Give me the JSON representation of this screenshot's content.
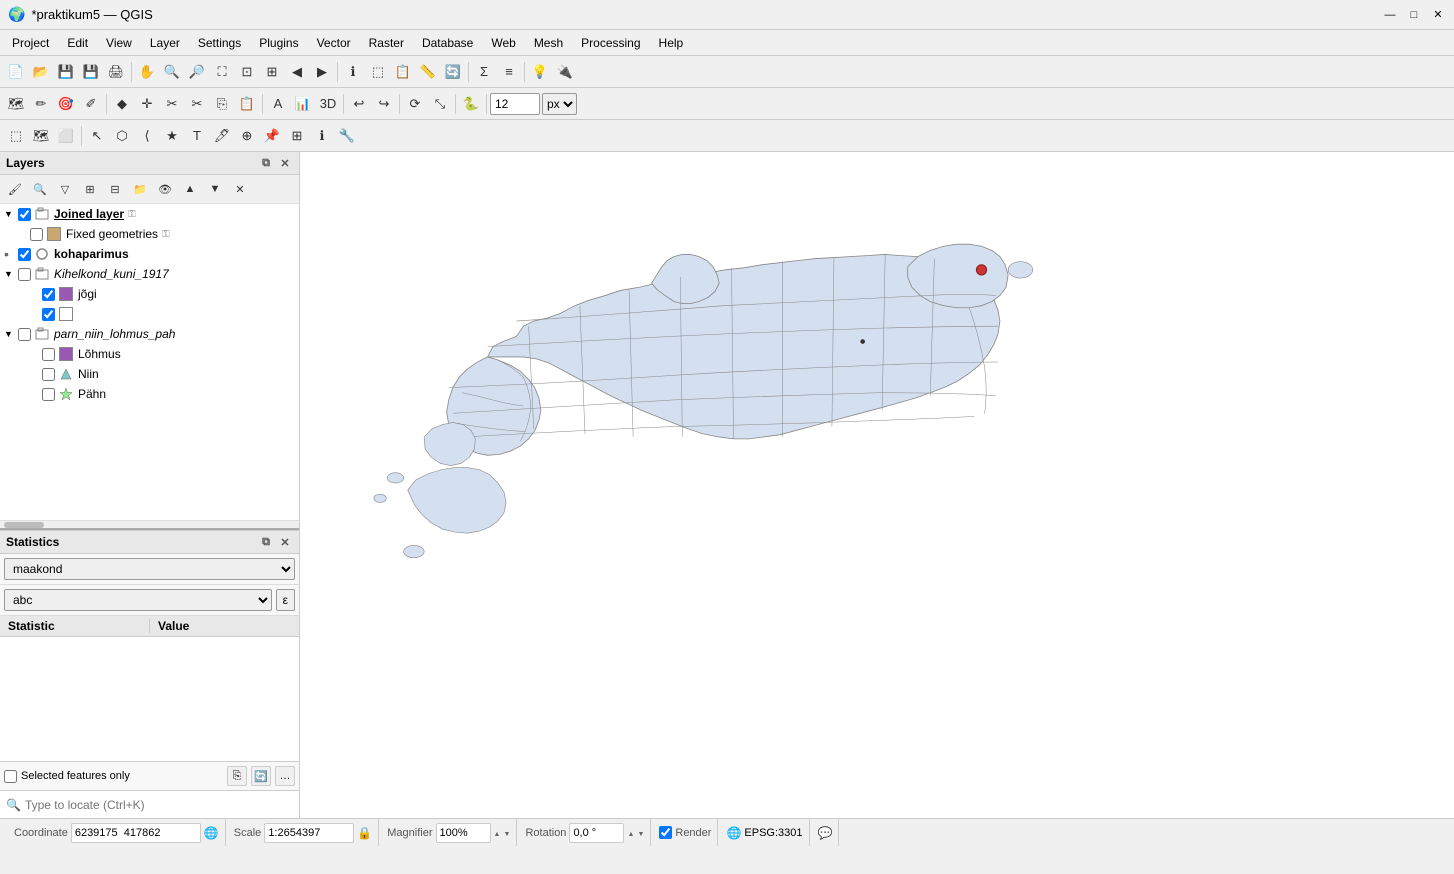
{
  "titleBar": {
    "title": "*praktikum5 — QGIS",
    "minimize": "—",
    "maximize": "□",
    "close": "✕"
  },
  "menuBar": {
    "items": [
      "Project",
      "Edit",
      "View",
      "Layer",
      "Settings",
      "Plugins",
      "Vector",
      "Raster",
      "Database",
      "Web",
      "Mesh",
      "Processing",
      "Help"
    ]
  },
  "toolbars": {
    "fontSizeValue": "12",
    "fontSizeUnit": "px"
  },
  "layersPanel": {
    "title": "Layers",
    "layers": [
      {
        "id": "joined-layer",
        "name": "Joined layer",
        "type": "group",
        "bold": true,
        "underline": true,
        "checked": true,
        "indent": 0,
        "expandable": true
      },
      {
        "id": "fixed-geometries",
        "name": "Fixed geometries",
        "type": "layer",
        "bold": false,
        "italic": false,
        "checked": false,
        "indent": 1,
        "color": "tan"
      },
      {
        "id": "kohaparimus",
        "name": "kohaparimus",
        "type": "layer",
        "bold": true,
        "checked": true,
        "indent": 0,
        "dot": true
      },
      {
        "id": "kihelkond",
        "name": "Kihelkond_kuni_1917",
        "type": "group",
        "italic": true,
        "checked": false,
        "indent": 0,
        "expandable": true
      },
      {
        "id": "jogi",
        "name": "jõgi",
        "type": "layer",
        "checked": true,
        "indent": 2,
        "color": "purple"
      },
      {
        "id": "blank-layer",
        "name": "",
        "type": "layer",
        "checked": true,
        "indent": 2,
        "color": "white"
      },
      {
        "id": "parn",
        "name": "parn_niin_lohmus_pah",
        "type": "group",
        "italic": true,
        "checked": false,
        "indent": 0,
        "expandable": true
      },
      {
        "id": "lohmus",
        "name": "Lõhmus",
        "type": "layer",
        "checked": false,
        "indent": 2,
        "color": "purple"
      },
      {
        "id": "niin",
        "name": "Niin",
        "type": "layer",
        "checked": false,
        "indent": 2,
        "triangle": true
      },
      {
        "id": "pahn",
        "name": "Pähn",
        "type": "layer",
        "checked": false,
        "indent": 2,
        "star": true
      }
    ]
  },
  "statisticsPanel": {
    "title": "Statistics",
    "layerDropdown": "maakond",
    "fieldDropdown": "abc",
    "columns": {
      "statistic": "Statistic",
      "value": "Value"
    },
    "footer": {
      "label": "Selected features only"
    }
  },
  "statusBar": {
    "coordinateLabel": "Coordinate",
    "coordinateValue": "6239175  417862",
    "scaleLabel": "Scale",
    "scaleValue": "1:2654397",
    "magnifierLabel": "Magnifier",
    "magnifierValue": "100%",
    "rotationLabel": "Rotation",
    "rotationValue": "0,0 °",
    "renderLabel": "Render",
    "epsgLabel": "EPSG:3301"
  },
  "locateBar": {
    "placeholder": "Type to locate (Ctrl+K)"
  }
}
